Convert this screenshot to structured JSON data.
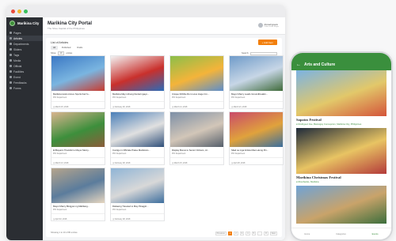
{
  "app": {
    "brand": "Marikina City",
    "title": "Marikina City Portal",
    "subtitle": "The Shoe Capital of the Philippines",
    "user_name": "Ahmad Ignacio",
    "user_role": "Office of the Mayor"
  },
  "sidebar": {
    "items": [
      {
        "label": "Pages"
      },
      {
        "label": "Articles",
        "active": true
      },
      {
        "label": "Departments"
      },
      {
        "label": "Sliders"
      },
      {
        "label": "Tags"
      },
      {
        "label": "Media"
      },
      {
        "label": "Official"
      },
      {
        "label": "Facilities"
      },
      {
        "label": "Event"
      },
      {
        "label": "Feedbacks"
      },
      {
        "label": "Forms"
      }
    ]
  },
  "panel": {
    "title": "List of Articles",
    "add_button": "+ Add Item",
    "tabs": [
      "All",
      "Published",
      "Drafts"
    ],
    "show_prefix": "Show",
    "show_value": "10",
    "show_suffix": "entries",
    "search_label": "Search:",
    "footer_info": "Showing 1 to 10 of 80 entries",
    "pagination": [
      "Previous",
      "1",
      "2",
      "3",
      "4",
      "5",
      "...",
      "8",
      "Next"
    ],
    "pagination_active": "1"
  },
  "articles": [
    {
      "title": "Marikina Hosts Annex Sports Fair fo...",
      "dept": "PIO Department",
      "date": "March 15, 2018",
      "colors": [
        "#3b78c4",
        "#7ab5e0",
        "#c93b2f"
      ]
    },
    {
      "title": "Marikina May Libreng Dental ngayo...",
      "dept": "PIO Department",
      "date": "February 26, 2018",
      "colors": [
        "#f2f2f2",
        "#c9302c",
        "#2b6bb8"
      ]
    },
    {
      "title": "Unique Dribble Run Lures Huge Cro...",
      "dept": "PIO Department",
      "date": "March 14, 2018",
      "colors": [
        "#8bbf4a",
        "#f4b43a",
        "#5d8ecb"
      ]
    },
    {
      "title": "Mayor Marcy Leads Groundbreakin...",
      "dept": "PIO Department",
      "date": "March 21, 2018",
      "colors": [
        "#6f9bc9",
        "#c7d6e6",
        "#3f6b3a"
      ]
    },
    {
      "title": "El Bayanic Thankful to Mayor Marcy...",
      "dept": "PIO Department",
      "date": "March 13, 2018",
      "colors": [
        "#d9b48f",
        "#3d8f3c",
        "#8c5c3a"
      ]
    },
    {
      "title": "Contigo in Officiale Praise Marikina's...",
      "dept": "PIO Department",
      "date": "February 28, 2018",
      "colors": [
        "#4a7fb8",
        "#e0e0e0",
        "#2f4f7a"
      ]
    },
    {
      "title": "Display Bonus to Senior Citizens, Al...",
      "dept": "PIO Department",
      "date": "March 15, 2018",
      "colors": [
        "#7d8fa6",
        "#d2c6b8",
        "#555f6b"
      ]
    },
    {
      "title": "Silad sa mga Artista Mas Lalong Pin...",
      "dept": "PIO Department",
      "date": "April 26, 2018",
      "colors": [
        "#c94a6a",
        "#e0a23c",
        "#3a6e9e"
      ]
    },
    {
      "title": "Mayor Marcy Binigyan ng Mabilang...",
      "dept": "PIO Department",
      "date": "April 10, 2018",
      "colors": [
        "#b5a48c",
        "#5b7c9c",
        "#e6d6c0"
      ]
    },
    {
      "title": "Dialawng Traveled to May Pinagpit...",
      "dept": "PIO Department",
      "date": "February 28, 2018",
      "colors": [
        "#8fb4d6",
        "#d8d8d8",
        "#3e6f9e"
      ]
    }
  ],
  "phone": {
    "header_title": "Arts and Culture",
    "items": [
      {
        "title": "Sapatos Festival",
        "sub": "Rodriguez Ave, Barangay Concepcion, Marikina City, Philippines",
        "colors": [
          "#7bb3e3",
          "#e2c86a",
          "#d4543a"
        ]
      },
      {
        "title": "Marikina Christmas Festival",
        "sub": "Riverbanks, Marikina",
        "colors": [
          "#1e2a3a",
          "#e8c463",
          "#b33a3a"
        ]
      },
      {
        "title": "",
        "sub": "",
        "colors": [
          "#6fa3d6",
          "#c9a36a",
          "#3c6e3c"
        ]
      }
    ],
    "nav": [
      "Home",
      "Categories",
      "Events"
    ],
    "nav_active": "Events"
  }
}
